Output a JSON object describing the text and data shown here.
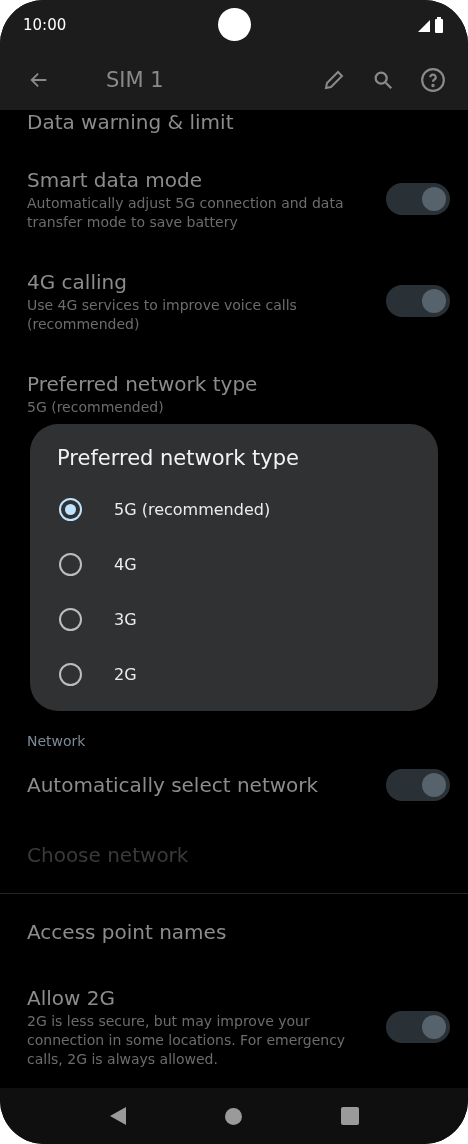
{
  "status_bar": {
    "time": "10:00"
  },
  "app_bar": {
    "title": "SIM 1"
  },
  "settings_top": [
    {
      "kind": "link",
      "title": "Data warning & limit"
    },
    {
      "kind": "toggle",
      "title": "Smart data mode",
      "subtitle": "Automatically adjust 5G connection and data transfer mode to save battery",
      "on": true
    },
    {
      "kind": "toggle",
      "title": "4G calling",
      "subtitle": "Use 4G services to improve voice calls (recommended)",
      "on": true
    },
    {
      "kind": "link",
      "title": "Preferred network type",
      "subtitle": "5G (recommended)"
    }
  ],
  "settings_bottom": [
    {
      "kind": "header",
      "title": "Network"
    },
    {
      "kind": "toggle",
      "title": "Automatically select network",
      "on": true
    },
    {
      "kind": "link",
      "title": "Choose network",
      "disabled": true
    },
    {
      "kind": "divider"
    },
    {
      "kind": "link",
      "title": "Access point names",
      "disabled": false
    },
    {
      "kind": "toggle",
      "title": "Allow 2G",
      "subtitle": "2G is less secure, but may improve your connection in some locations. For emergency calls, 2G is always allowed.",
      "on": true
    }
  ],
  "dialog": {
    "title": "Preferred network type",
    "options": [
      {
        "label": "5G (recommended)",
        "selected": true
      },
      {
        "label": "4G",
        "selected": false
      },
      {
        "label": "3G",
        "selected": false
      },
      {
        "label": "2G",
        "selected": false
      }
    ]
  }
}
